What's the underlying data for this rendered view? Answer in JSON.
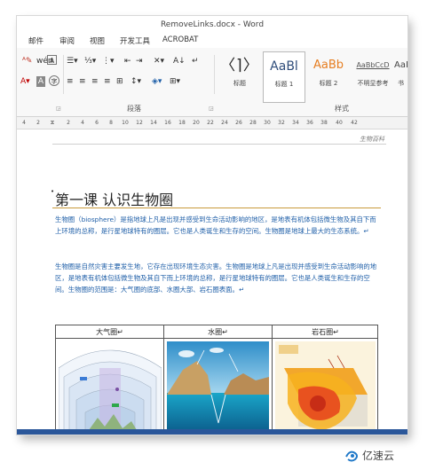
{
  "window": {
    "title": "RemoveLinks.docx - Word"
  },
  "menu": {
    "items": [
      "邮件",
      "审阅",
      "视图",
      "开发工具",
      "ACROBAT"
    ]
  },
  "ribbon": {
    "paragraph_group_label": "段落",
    "styles_group_label": "样式",
    "styles": [
      {
        "preview": "〈⌉〉",
        "name": "标题"
      },
      {
        "preview": "AaBl",
        "name": "标题 1"
      },
      {
        "preview": "AaBb",
        "name": "标题 2"
      },
      {
        "preview": "AaBbCcD",
        "name": "不明显参考"
      },
      {
        "preview": "AaI",
        "name": "书"
      }
    ]
  },
  "ruler": {
    "ticks": [
      "4",
      "2",
      "2",
      "4",
      "6",
      "8",
      "10",
      "12",
      "14",
      "16",
      "18",
      "20",
      "22",
      "24",
      "26",
      "28",
      "30",
      "32",
      "34",
      "36",
      "38",
      "40",
      "42"
    ]
  },
  "document": {
    "header": "生物百科",
    "title": "第一课  认识生物圈",
    "paragraphs": [
      "生物圈（biosphere）是指地球上凡是出现并感受到生命活动影响的地区，是地表有机体包括微生物及其自下而上环境的总称，是行星地球特有的圈层。它也是人类诞生和生存的空间。生物圈是地球上最大的生态系统。↵",
      "生物圈是自然灾害主要发生地，它存在出现环境生态灾害。生物圈是地球上凡是出现并感受到生命活动影响的地区，是地表有机体包括微生物及其自下而上环境的总称，是行星地球特有的圈层。它也是人类诞生和生存的空间。生物圈的范围是：大气圈的底部、水圈大部、岩石圈表面。↵"
    ],
    "table_headers": [
      "大气圈↵",
      "水圈↵",
      "岩石圈↵"
    ]
  },
  "watermark": {
    "text": "亿速云"
  },
  "colors": {
    "accent": "#2b579a",
    "body_text": "#1f5fa8",
    "title_rule": "#c99a3a"
  }
}
